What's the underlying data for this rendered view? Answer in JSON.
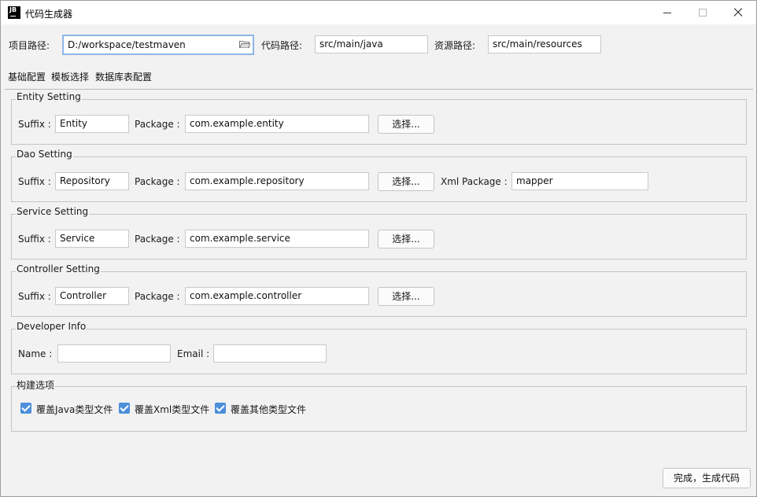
{
  "window": {
    "app_icon": "JB",
    "title": "代码生成器"
  },
  "paths": {
    "project_label": "项目路径:",
    "project_value": "D:/workspace/testmaven",
    "code_label": "代码路径:",
    "code_value": "src/main/java",
    "resource_label": "资源路径:",
    "resource_value": "src/main/resources"
  },
  "tabs": [
    "基础配置",
    "模板选择",
    "数据库表配置"
  ],
  "groups": {
    "entity": {
      "title": "Entity Setting",
      "suffix_label": "Suffix :",
      "suffix_value": "Entity",
      "package_label": "Package :",
      "package_value": "com.example.entity",
      "choose_label": "选择..."
    },
    "dao": {
      "title": "Dao Setting",
      "suffix_label": "Suffix :",
      "suffix_value": "Repository",
      "package_label": "Package :",
      "package_value": "com.example.repository",
      "choose_label": "选择...",
      "xml_label": "Xml Package :",
      "xml_value": "mapper"
    },
    "service": {
      "title": "Service Setting",
      "suffix_label": "Suffix :",
      "suffix_value": "Service",
      "package_label": "Package :",
      "package_value": "com.example.service",
      "choose_label": "选择..."
    },
    "controller": {
      "title": "Controller Setting",
      "suffix_label": "Suffix :",
      "suffix_value": "Controller",
      "package_label": "Package :",
      "package_value": "com.example.controller",
      "choose_label": "选择..."
    },
    "developer": {
      "title": "Developer Info",
      "name_label": "Name :",
      "name_value": "",
      "email_label": "Email :",
      "email_value": ""
    },
    "build": {
      "title": "构建选项",
      "options": [
        {
          "label": "覆盖Java类型文件",
          "checked": true
        },
        {
          "label": "覆盖Xml类型文件",
          "checked": true
        },
        {
          "label": "覆盖其他类型文件",
          "checked": true
        }
      ]
    }
  },
  "footer": {
    "finish_label": "完成，生成代码"
  },
  "colors": {
    "accent": "#4c8fdb",
    "focus_border": "#8eb7e8"
  }
}
